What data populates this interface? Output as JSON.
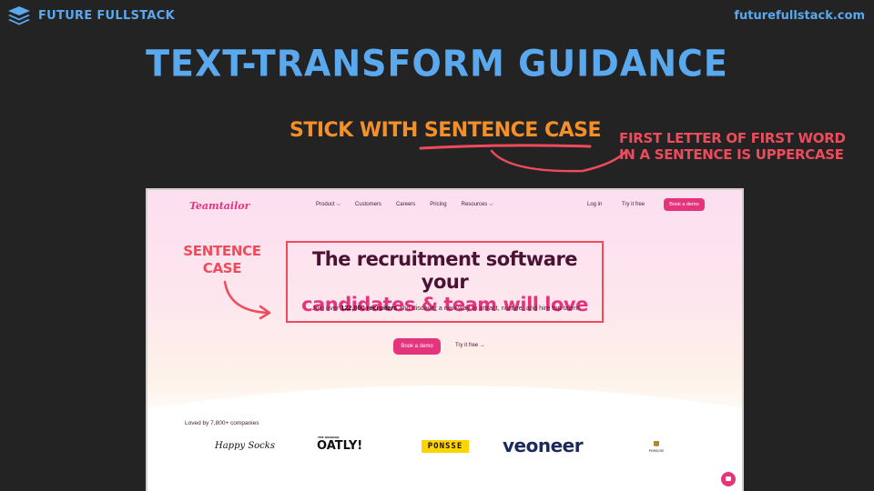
{
  "slide": {
    "brand_name": "FUTURE FULLSTACK",
    "site_url": "futurefullstack.com",
    "title": "TEXT-TRANSFORM GUIDANCE",
    "stick_prefix": "STICK WITH ",
    "stick_emph": "SENTENCE CASE",
    "note_line1": "FIRST LETTER OF FIRST WORD",
    "note_line2": "IN A SENTENCE IS UPPERCASE",
    "sentence_case_line1": "SENTENCE",
    "sentence_case_line2": "CASE",
    "colors": {
      "background": "#232323",
      "title_blue": "#5aa8ee",
      "orange": "#f4902a",
      "red": "#ef4b5c"
    }
  },
  "site": {
    "logo": "Teamtailor",
    "nav": [
      {
        "label": "Product",
        "has_caret": true
      },
      {
        "label": "Customers",
        "has_caret": false
      },
      {
        "label": "Careers",
        "has_caret": false
      },
      {
        "label": "Pricing",
        "has_caret": false
      },
      {
        "label": "Resources",
        "has_caret": true
      }
    ],
    "login": "Log in",
    "try_free": "Try it free",
    "book_demo": "Book a demo",
    "headline_line1": "The recruitment software your",
    "headline_line2": "candidates & team will love",
    "subtext_prefix": "Join over ",
    "subtext_bold": "122,000 recruiters",
    "subtext_suffix": " and discover a new way to attract, nurture, and hire top talent.",
    "cta_primary": "Book a demo",
    "cta_secondary": "Try it free →",
    "loved_by": "Loved by 7,800+ companies",
    "customer_logos": {
      "happy_socks": "Happy Socks",
      "oatly_small": "THE ORIGINAL",
      "oatly": "OATLY!",
      "ponsse": "PONSSE",
      "veoneer": "veoneer",
      "porsche": "PORSCHE"
    },
    "accent": "#e4357c"
  }
}
